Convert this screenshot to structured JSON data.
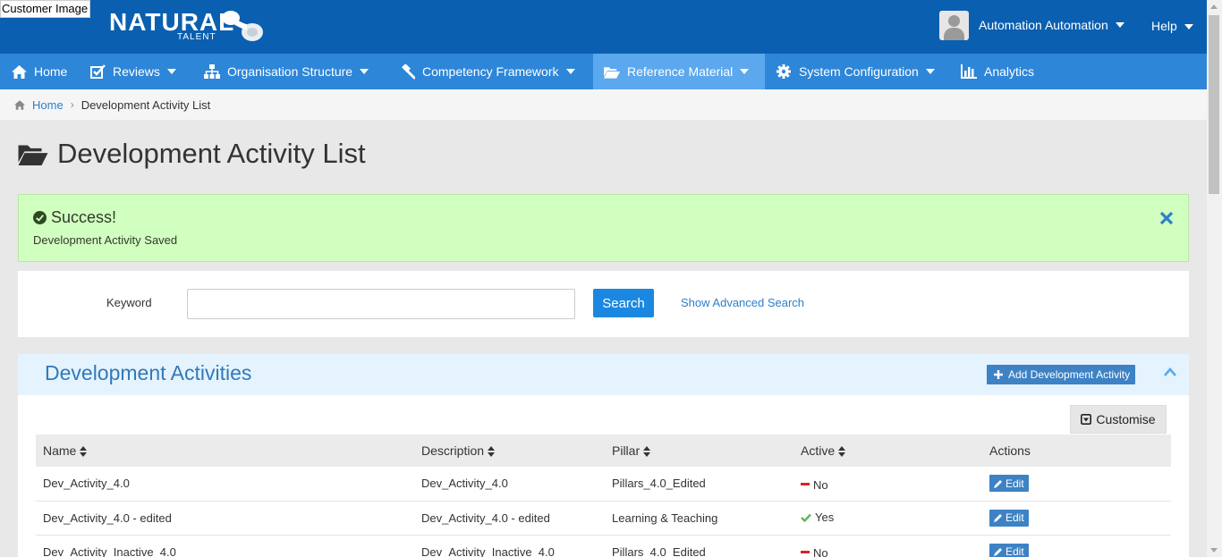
{
  "overlay": {
    "label": "Customer Image"
  },
  "brand": {
    "word": "NATURAL",
    "sub": "TALENT"
  },
  "header": {
    "user_name": "Automation Automation",
    "help": "Help"
  },
  "nav": {
    "items": [
      {
        "label": "Home",
        "icon": "home-icon",
        "dropdown": false
      },
      {
        "label": "Reviews",
        "icon": "checkbox-icon",
        "dropdown": true
      },
      {
        "label": "Organisation Structure",
        "icon": "sitemap-icon",
        "dropdown": true
      },
      {
        "label": "Competency Framework",
        "icon": "gavel-icon",
        "dropdown": true
      },
      {
        "label": "Reference Material",
        "icon": "folder-open-icon",
        "dropdown": true,
        "active": true
      },
      {
        "label": "System Configuration",
        "icon": "gear-icon",
        "dropdown": true
      },
      {
        "label": "Analytics",
        "icon": "bar-chart-icon",
        "dropdown": false
      }
    ]
  },
  "breadcrumb": {
    "home": "Home",
    "current": "Development Activity List"
  },
  "page": {
    "title": "Development Activity List"
  },
  "alert": {
    "title": "Success!",
    "message": "Development Activity Saved"
  },
  "search": {
    "label": "Keyword",
    "value": "",
    "button": "Search",
    "advanced": "Show Advanced Search"
  },
  "panel": {
    "title": "Development Activities",
    "add_label": "Add Development Activity",
    "customise_label": "Customise"
  },
  "table": {
    "columns": [
      "Name",
      "Description",
      "Pillar",
      "Active",
      "Actions"
    ],
    "rows": [
      {
        "name": "Dev_Activity_4.0",
        "description": "Dev_Activity_4.0",
        "pillar": "Pillars_4.0_Edited",
        "active": "No",
        "action": "Edit"
      },
      {
        "name": "Dev_Activity_4.0 - edited",
        "description": "Dev_Activity_4.0 - edited",
        "pillar": "Learning & Teaching",
        "active": "Yes",
        "action": "Edit"
      },
      {
        "name": "Dev_Activity_Inactive_4.0",
        "description": "Dev_Activity_Inactive_4.0",
        "pillar": "Pillars_4.0_Edited",
        "active": "No",
        "action": "Edit"
      }
    ]
  },
  "colors": {
    "header": "#0a5fb0",
    "nav": "#2d86d8",
    "nav_active": "#5ba8ee",
    "success_bg": "#d1ffc0",
    "link": "#2d7fc7",
    "no": "#d9242a",
    "yes": "#5cb85c"
  }
}
